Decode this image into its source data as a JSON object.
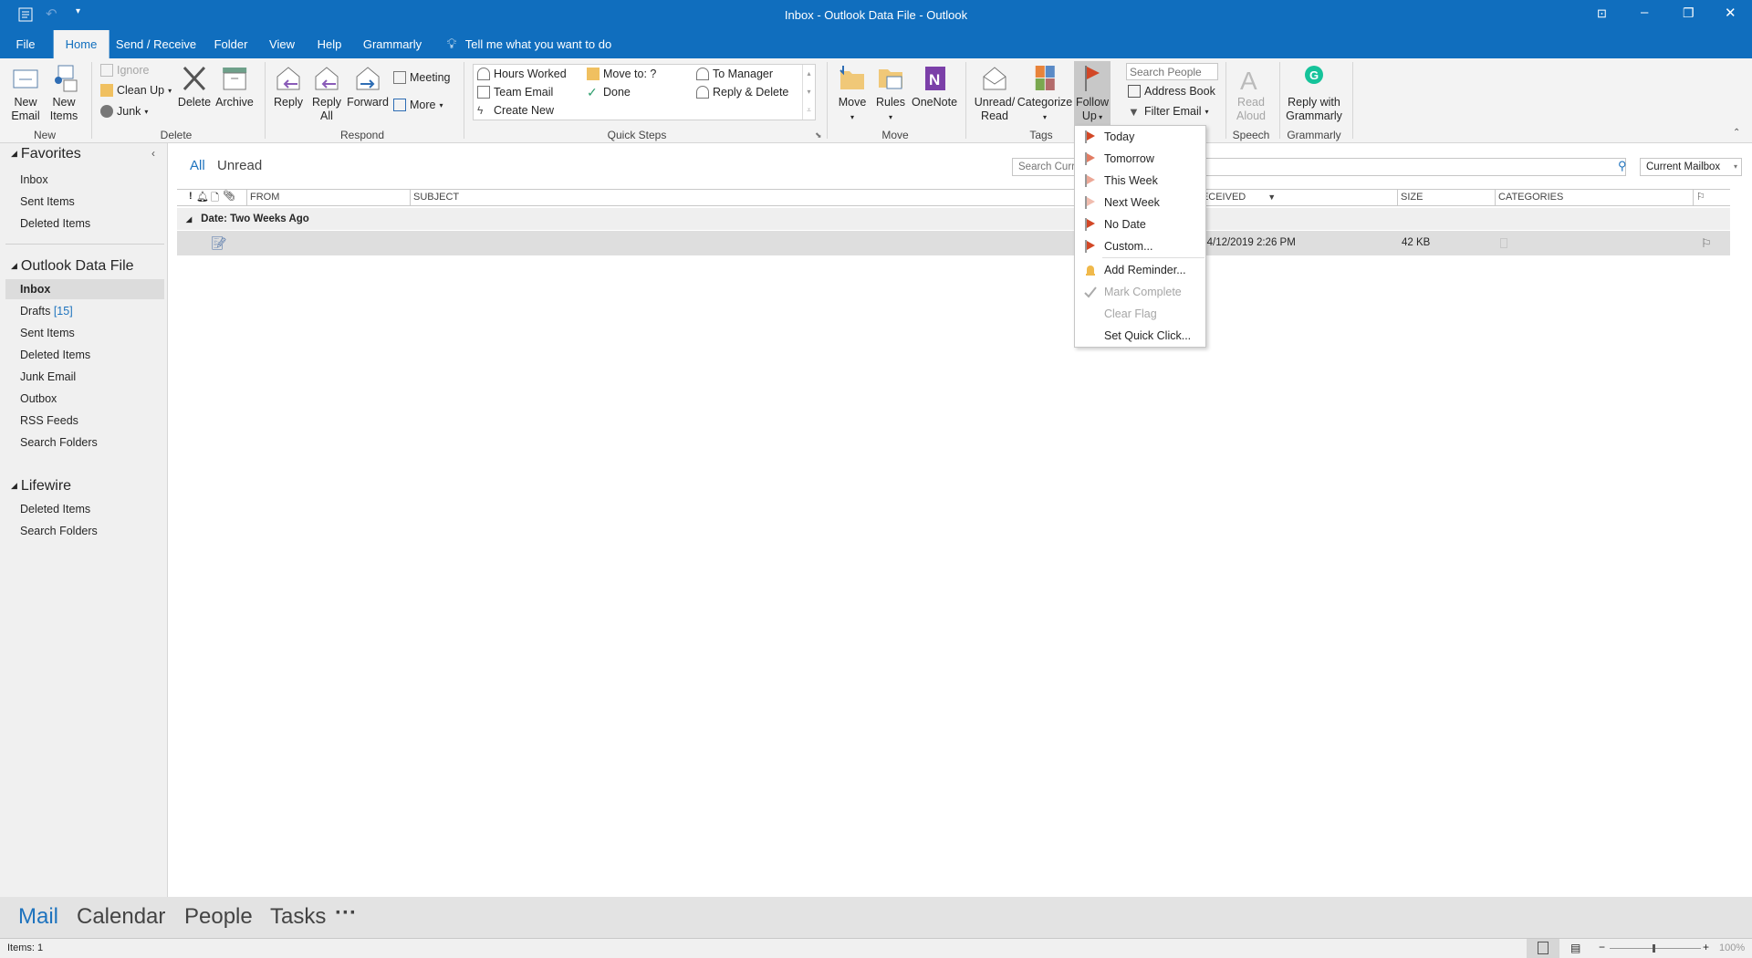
{
  "window": {
    "title": "Inbox - Outlook Data File  -  Outlook"
  },
  "ribbon_tabs": [
    "File",
    "Home",
    "Send / Receive",
    "Folder",
    "View",
    "Help",
    "Grammarly"
  ],
  "tell_me": "Tell me what you want to do",
  "ribbon": {
    "new": {
      "label": "New",
      "new_email": "New Email",
      "new_items": "New Items"
    },
    "delete": {
      "label": "Delete",
      "ignore": "Ignore",
      "clean_up": "Clean Up",
      "junk": "Junk",
      "delete": "Delete",
      "archive": "Archive"
    },
    "respond": {
      "label": "Respond",
      "reply": "Reply",
      "reply_all": "Reply All",
      "forward": "Forward",
      "meeting": "Meeting",
      "more": "More"
    },
    "quick_steps": {
      "label": "Quick Steps",
      "items": [
        "Hours Worked",
        "Team Email",
        "Create New",
        "Move to: ?",
        "Done",
        "To Manager",
        "Reply & Delete"
      ]
    },
    "move": {
      "label": "Move",
      "move": "Move",
      "rules": "Rules",
      "onenote": "OneNote"
    },
    "tags": {
      "label": "Tags",
      "unread_read": "Unread/ Read",
      "categorize": "Categorize",
      "follow_up": "Follow Up"
    },
    "find": {
      "search_people_placeholder": "Search People",
      "address_book": "Address Book",
      "filter_email": "Filter Email"
    },
    "speech": {
      "label": "Speech",
      "read_aloud": "Read Aloud"
    },
    "grammarly": {
      "label": "Grammarly",
      "reply_with": "Reply with Grammarly"
    }
  },
  "folders": {
    "favorites": {
      "title": "Favorites",
      "items": [
        "Inbox",
        "Sent Items",
        "Deleted Items"
      ]
    },
    "data_file": {
      "title": "Outlook Data File",
      "items": [
        {
          "label": "Inbox",
          "selected": true
        },
        {
          "label": "Drafts",
          "count": "[15]"
        },
        {
          "label": "Sent Items"
        },
        {
          "label": "Deleted Items"
        },
        {
          "label": "Junk Email"
        },
        {
          "label": "Outbox"
        },
        {
          "label": "RSS Feeds"
        },
        {
          "label": "Search Folders"
        }
      ]
    },
    "lifewire": {
      "title": "Lifewire",
      "items": [
        "Deleted Items",
        "Search Folders"
      ]
    }
  },
  "mail": {
    "filters": [
      "All",
      "Unread"
    ],
    "search_placeholder": "Search Current Mailbox",
    "scope": "Current Mailbox",
    "columns": {
      "from": "FROM",
      "subject": "SUBJECT",
      "received": "RECEIVED",
      "size": "SIZE",
      "categories": "CATEGORIES"
    },
    "group": "Date: Two Weeks Ago",
    "rows": [
      {
        "received": "Fri 4/12/2019 2:26 PM",
        "size": "42 KB"
      }
    ]
  },
  "follow_up_menu": [
    {
      "label": "Today",
      "icon": "flag-icon",
      "color": "#d24726"
    },
    {
      "label": "Tomorrow",
      "icon": "flag-icon",
      "color": "#e27c63"
    },
    {
      "label": "This Week",
      "icon": "flag-icon",
      "color": "#eca796"
    },
    {
      "label": "Next Week",
      "icon": "flag-icon",
      "color": "#f0bcae"
    },
    {
      "label": "No Date",
      "icon": "flag-icon",
      "color": "#d24726"
    },
    {
      "label": "Custom...",
      "icon": "flag-icon",
      "color": "#d24726"
    },
    {
      "label": "Add Reminder...",
      "icon": "bell-icon",
      "color": "#f0b94b"
    },
    {
      "label": "Mark Complete",
      "icon": "check-icon",
      "disabled": true
    },
    {
      "label": "Clear Flag",
      "disabled": true
    },
    {
      "label": "Set Quick Click..."
    }
  ],
  "nav": [
    "Mail",
    "Calendar",
    "People",
    "Tasks",
    "···"
  ],
  "status": {
    "items": "Items: 1",
    "zoom": "100%"
  },
  "colors": {
    "accent": "#106ebe",
    "flag": "#d24726"
  }
}
